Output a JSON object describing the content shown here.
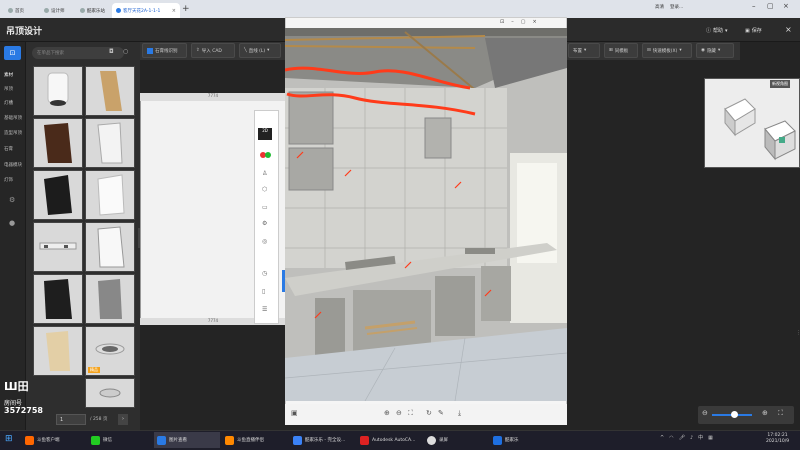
{
  "browser": {
    "tabs": [
      {
        "label": "首页"
      },
      {
        "label": "设计师"
      },
      {
        "label": "酷家乐站"
      },
      {
        "label": "客厅天花2A-1-1-1"
      }
    ],
    "right_items": [
      "高清",
      "登录..."
    ]
  },
  "app": {
    "title": "吊顶设计",
    "help": "帮助",
    "save": "保存"
  },
  "toolbar": {
    "buttons": [
      "石膏线识别",
      "导入 CAD",
      "直线 (L)"
    ],
    "right_buttons": [
      "布置",
      "同模板",
      "快速模板(X)",
      "隐藏"
    ]
  },
  "sidebar": {
    "categories": [
      "素材",
      "吊顶",
      "灯槽",
      "基础吊顶",
      "造型吊顶",
      "石膏",
      "电器模块",
      "灯饰"
    ]
  },
  "materials": {
    "search_placeholder": "在单品下搜索",
    "badge": "精品",
    "page_current": "1",
    "page_total": "/ 258 页"
  },
  "watermark": {
    "logo": "Ш田",
    "label": "房间号",
    "room": "3572758"
  },
  "canvas": {
    "ruler_top": "7774",
    "ruler_bottom": "7774"
  },
  "preview": {
    "label": "新视角图"
  },
  "taskbar": {
    "items": [
      "斗鱼客户端",
      "微信",
      "图片查看",
      "斗鱼直播伴侣",
      "酷家乐乐 - 完全设...",
      "Autodesk AutoCA...",
      "录屏",
      "酷家乐"
    ],
    "time": "17:02:21",
    "date": "2021/10/9"
  },
  "colors": {
    "accent": "#2a7ae4",
    "annotation": "#ff3b1a",
    "background": "#242424"
  }
}
